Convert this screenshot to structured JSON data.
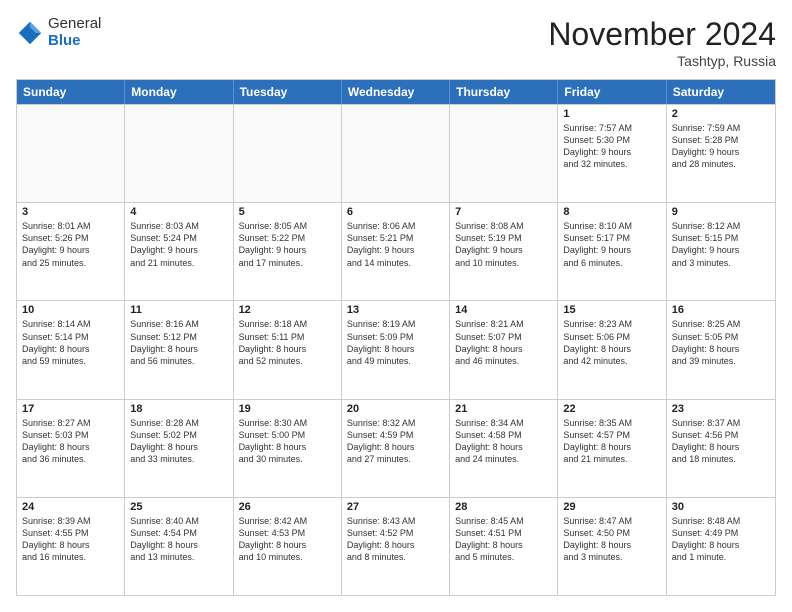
{
  "header": {
    "logo_general": "General",
    "logo_blue": "Blue",
    "month_title": "November 2024",
    "location": "Tashtyp, Russia"
  },
  "weekdays": [
    "Sunday",
    "Monday",
    "Tuesday",
    "Wednesday",
    "Thursday",
    "Friday",
    "Saturday"
  ],
  "rows": [
    [
      {
        "day": "",
        "info": ""
      },
      {
        "day": "",
        "info": ""
      },
      {
        "day": "",
        "info": ""
      },
      {
        "day": "",
        "info": ""
      },
      {
        "day": "",
        "info": ""
      },
      {
        "day": "1",
        "info": "Sunrise: 7:57 AM\nSunset: 5:30 PM\nDaylight: 9 hours\nand 32 minutes."
      },
      {
        "day": "2",
        "info": "Sunrise: 7:59 AM\nSunset: 5:28 PM\nDaylight: 9 hours\nand 28 minutes."
      }
    ],
    [
      {
        "day": "3",
        "info": "Sunrise: 8:01 AM\nSunset: 5:26 PM\nDaylight: 9 hours\nand 25 minutes."
      },
      {
        "day": "4",
        "info": "Sunrise: 8:03 AM\nSunset: 5:24 PM\nDaylight: 9 hours\nand 21 minutes."
      },
      {
        "day": "5",
        "info": "Sunrise: 8:05 AM\nSunset: 5:22 PM\nDaylight: 9 hours\nand 17 minutes."
      },
      {
        "day": "6",
        "info": "Sunrise: 8:06 AM\nSunset: 5:21 PM\nDaylight: 9 hours\nand 14 minutes."
      },
      {
        "day": "7",
        "info": "Sunrise: 8:08 AM\nSunset: 5:19 PM\nDaylight: 9 hours\nand 10 minutes."
      },
      {
        "day": "8",
        "info": "Sunrise: 8:10 AM\nSunset: 5:17 PM\nDaylight: 9 hours\nand 6 minutes."
      },
      {
        "day": "9",
        "info": "Sunrise: 8:12 AM\nSunset: 5:15 PM\nDaylight: 9 hours\nand 3 minutes."
      }
    ],
    [
      {
        "day": "10",
        "info": "Sunrise: 8:14 AM\nSunset: 5:14 PM\nDaylight: 8 hours\nand 59 minutes."
      },
      {
        "day": "11",
        "info": "Sunrise: 8:16 AM\nSunset: 5:12 PM\nDaylight: 8 hours\nand 56 minutes."
      },
      {
        "day": "12",
        "info": "Sunrise: 8:18 AM\nSunset: 5:11 PM\nDaylight: 8 hours\nand 52 minutes."
      },
      {
        "day": "13",
        "info": "Sunrise: 8:19 AM\nSunset: 5:09 PM\nDaylight: 8 hours\nand 49 minutes."
      },
      {
        "day": "14",
        "info": "Sunrise: 8:21 AM\nSunset: 5:07 PM\nDaylight: 8 hours\nand 46 minutes."
      },
      {
        "day": "15",
        "info": "Sunrise: 8:23 AM\nSunset: 5:06 PM\nDaylight: 8 hours\nand 42 minutes."
      },
      {
        "day": "16",
        "info": "Sunrise: 8:25 AM\nSunset: 5:05 PM\nDaylight: 8 hours\nand 39 minutes."
      }
    ],
    [
      {
        "day": "17",
        "info": "Sunrise: 8:27 AM\nSunset: 5:03 PM\nDaylight: 8 hours\nand 36 minutes."
      },
      {
        "day": "18",
        "info": "Sunrise: 8:28 AM\nSunset: 5:02 PM\nDaylight: 8 hours\nand 33 minutes."
      },
      {
        "day": "19",
        "info": "Sunrise: 8:30 AM\nSunset: 5:00 PM\nDaylight: 8 hours\nand 30 minutes."
      },
      {
        "day": "20",
        "info": "Sunrise: 8:32 AM\nSunset: 4:59 PM\nDaylight: 8 hours\nand 27 minutes."
      },
      {
        "day": "21",
        "info": "Sunrise: 8:34 AM\nSunset: 4:58 PM\nDaylight: 8 hours\nand 24 minutes."
      },
      {
        "day": "22",
        "info": "Sunrise: 8:35 AM\nSunset: 4:57 PM\nDaylight: 8 hours\nand 21 minutes."
      },
      {
        "day": "23",
        "info": "Sunrise: 8:37 AM\nSunset: 4:56 PM\nDaylight: 8 hours\nand 18 minutes."
      }
    ],
    [
      {
        "day": "24",
        "info": "Sunrise: 8:39 AM\nSunset: 4:55 PM\nDaylight: 8 hours\nand 16 minutes."
      },
      {
        "day": "25",
        "info": "Sunrise: 8:40 AM\nSunset: 4:54 PM\nDaylight: 8 hours\nand 13 minutes."
      },
      {
        "day": "26",
        "info": "Sunrise: 8:42 AM\nSunset: 4:53 PM\nDaylight: 8 hours\nand 10 minutes."
      },
      {
        "day": "27",
        "info": "Sunrise: 8:43 AM\nSunset: 4:52 PM\nDaylight: 8 hours\nand 8 minutes."
      },
      {
        "day": "28",
        "info": "Sunrise: 8:45 AM\nSunset: 4:51 PM\nDaylight: 8 hours\nand 5 minutes."
      },
      {
        "day": "29",
        "info": "Sunrise: 8:47 AM\nSunset: 4:50 PM\nDaylight: 8 hours\nand 3 minutes."
      },
      {
        "day": "30",
        "info": "Sunrise: 8:48 AM\nSunset: 4:49 PM\nDaylight: 8 hours\nand 1 minute."
      }
    ]
  ]
}
